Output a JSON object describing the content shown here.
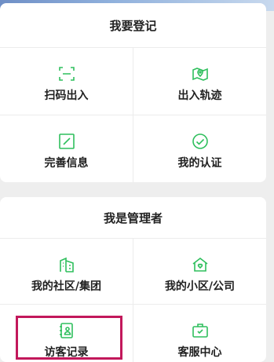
{
  "theme": {
    "accent": "#2fbf5d",
    "highlight": "#c2185b"
  },
  "register": {
    "title": "我要登记",
    "items": [
      {
        "label": "扫码出入",
        "icon": "scan-icon"
      },
      {
        "label": "出入轨迹",
        "icon": "map-pin-icon"
      },
      {
        "label": "完善信息",
        "icon": "edit-icon"
      },
      {
        "label": "我的认证",
        "icon": "check-circle-icon"
      }
    ]
  },
  "manager": {
    "title": "我是管理者",
    "items": [
      {
        "label": "我的社区/集团",
        "icon": "building-icon"
      },
      {
        "label": "我的小区/公司",
        "icon": "house-icon"
      },
      {
        "label": "访客记录",
        "icon": "visitor-record-icon"
      },
      {
        "label": "客服中心",
        "icon": "service-bag-icon"
      }
    ]
  }
}
